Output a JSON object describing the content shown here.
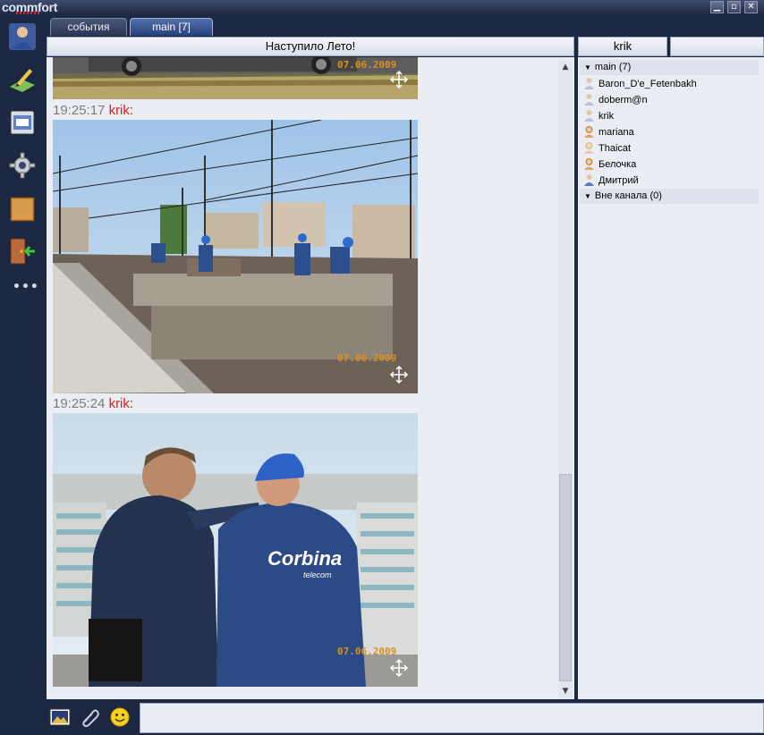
{
  "app": {
    "logo": "commfort"
  },
  "tabs": [
    {
      "label": "события",
      "active": false
    },
    {
      "label": "main [7]",
      "active": true
    }
  ],
  "topic": "Наступило Лето!",
  "current_user": "krik",
  "messages": [
    {
      "time": "19:25:17",
      "nick": "krik:",
      "photo_date": "07.06.2009",
      "photo": "rooftop-workers-antennas"
    },
    {
      "time": "19:25:24",
      "nick": "krik:",
      "photo_date": "07.06.2009",
      "photo": "men-corbina-jackets"
    }
  ],
  "first_photo_date": "07.06.2009",
  "sidebar_icons": [
    "user-profile-icon",
    "edit-note-icon",
    "news-board-icon",
    "settings-gear-icon",
    "folder-icon",
    "exit-door-icon"
  ],
  "sidebar_more": "•••",
  "channel_group": "main (7)",
  "users": [
    {
      "name": "Baron_D'e_Fetenbakh",
      "gender": "male"
    },
    {
      "name": "doberm@n",
      "gender": "male"
    },
    {
      "name": "krik",
      "gender": "male"
    },
    {
      "name": "mariana",
      "gender": "female"
    },
    {
      "name": "Thaicat",
      "gender": "female"
    },
    {
      "name": "Белочка",
      "gender": "female"
    },
    {
      "name": "Дмитрий",
      "gender": "male"
    }
  ],
  "offline_group": "Вне канала (0)",
  "bottom_tools": [
    "image-icon",
    "attach-paperclip-icon",
    "smiley-icon"
  ],
  "colors": {
    "nick": "#d81b1b",
    "time": "#7c7c7c",
    "active_tab": "#26407c",
    "chrome": "#1c2742"
  }
}
